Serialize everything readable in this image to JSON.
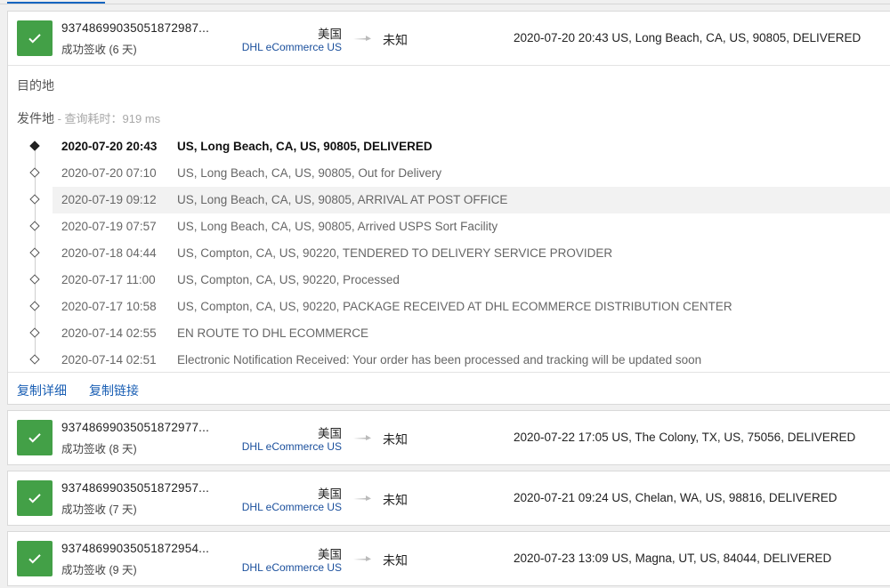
{
  "items": [
    {
      "tracking": "93748699035051872987...",
      "status": "成功签收 (6 天)",
      "country": "美国",
      "carrier": "DHL eCommerce US",
      "destination": "未知",
      "latest": "2020-07-20 20:43  US, Long Beach, CA, US, 90805, DELIVERED"
    },
    {
      "tracking": "93748699035051872977...",
      "status": "成功签收 (8 天)",
      "country": "美国",
      "carrier": "DHL eCommerce US",
      "destination": "未知",
      "latest": "2020-07-22 17:05  US, The Colony, TX, US, 75056, DELIVERED"
    },
    {
      "tracking": "93748699035051872957...",
      "status": "成功签收 (7 天)",
      "country": "美国",
      "carrier": "DHL eCommerce US",
      "destination": "未知",
      "latest": "2020-07-21 09:24  US, Chelan, WA, US, 98816, DELIVERED"
    },
    {
      "tracking": "93748699035051872954...",
      "status": "成功签收 (9 天)",
      "country": "美国",
      "carrier": "DHL eCommerce US",
      "destination": "未知",
      "latest": "2020-07-23 13:09  US, Magna, UT, US, 84044, DELIVERED"
    }
  ],
  "details": {
    "destination_label": "目的地",
    "origin_label": "发件地",
    "query_time": " - 查询耗时：919 ms",
    "events": [
      {
        "date": "2020-07-20 20:43",
        "desc": "US, Long Beach, CA, US, 90805, DELIVERED"
      },
      {
        "date": "2020-07-20 07:10",
        "desc": "US, Long Beach, CA, US, 90805, Out for Delivery"
      },
      {
        "date": "2020-07-19 09:12",
        "desc": "US, Long Beach, CA, US, 90805, ARRIVAL AT POST OFFICE"
      },
      {
        "date": "2020-07-19 07:57",
        "desc": "US, Long Beach, CA, US, 90805, Arrived USPS Sort Facility"
      },
      {
        "date": "2020-07-18 04:44",
        "desc": "US, Compton, CA, US, 90220, TENDERED TO DELIVERY SERVICE PROVIDER"
      },
      {
        "date": "2020-07-17 11:00",
        "desc": "US, Compton, CA, US, 90220, Processed"
      },
      {
        "date": "2020-07-17 10:58",
        "desc": "US, Compton, CA, US, 90220, PACKAGE RECEIVED AT DHL ECOMMERCE DISTRIBUTION CENTER"
      },
      {
        "date": "2020-07-14 02:55",
        "desc": "EN ROUTE TO DHL ECOMMERCE"
      },
      {
        "date": "2020-07-14 02:51",
        "desc": "Electronic Notification Received: Your order has been processed and tracking will be updated soon"
      }
    ],
    "copy_details_label": "复制详细",
    "copy_link_label": "复制链接"
  },
  "colors": {
    "check_green": "#43a047",
    "link_blue": "#1a5fb4",
    "carrier_blue": "#1a4f9c"
  }
}
